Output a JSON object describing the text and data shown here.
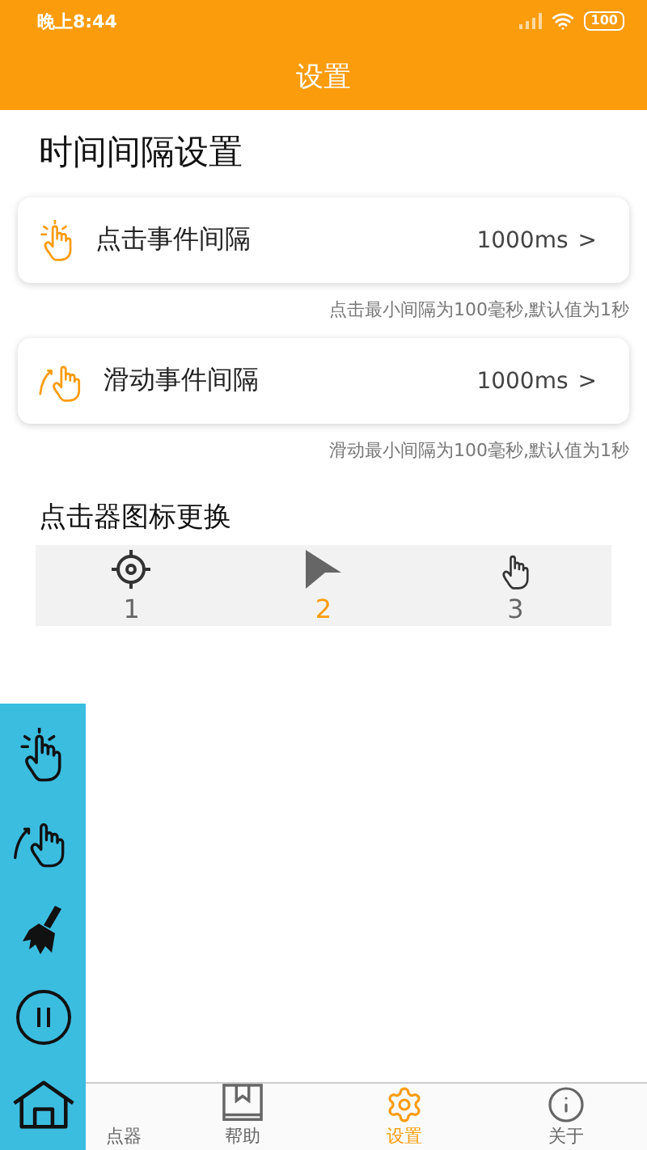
{
  "status_bar": {
    "time": "晚上8:44",
    "battery": "100"
  },
  "header": {
    "title": "设置"
  },
  "interval_section": {
    "title": "时间间隔设置",
    "settings": [
      {
        "kind": "tap",
        "label": "点击事件间隔",
        "value": "1000ms",
        "chevron": ">",
        "hint": "点击最小间隔为100毫秒,默认值为1秒"
      },
      {
        "kind": "swipe",
        "label": "滑动事件间隔",
        "value": "1000ms",
        "chevron": ">",
        "hint": "滑动最小间隔为100毫秒,默认值为1秒"
      }
    ]
  },
  "icon_section": {
    "title": "点击器图标更换",
    "options": [
      {
        "kind": "target",
        "label": "1",
        "selected": false
      },
      {
        "kind": "arrow",
        "label": "2",
        "selected": true
      },
      {
        "kind": "hand",
        "label": "3",
        "selected": false
      }
    ]
  },
  "floating_panel": {
    "buttons": [
      {
        "kind": "tap"
      },
      {
        "kind": "swipe"
      },
      {
        "kind": "clean"
      },
      {
        "kind": "pause"
      },
      {
        "kind": "home"
      }
    ]
  },
  "bottom_nav": [
    {
      "kind": "clicker",
      "label": "点器",
      "selected": false
    },
    {
      "kind": "help",
      "label": "帮助",
      "selected": false
    },
    {
      "kind": "settings",
      "label": "设置",
      "selected": true
    },
    {
      "kind": "about",
      "label": "关于",
      "selected": false
    }
  ]
}
